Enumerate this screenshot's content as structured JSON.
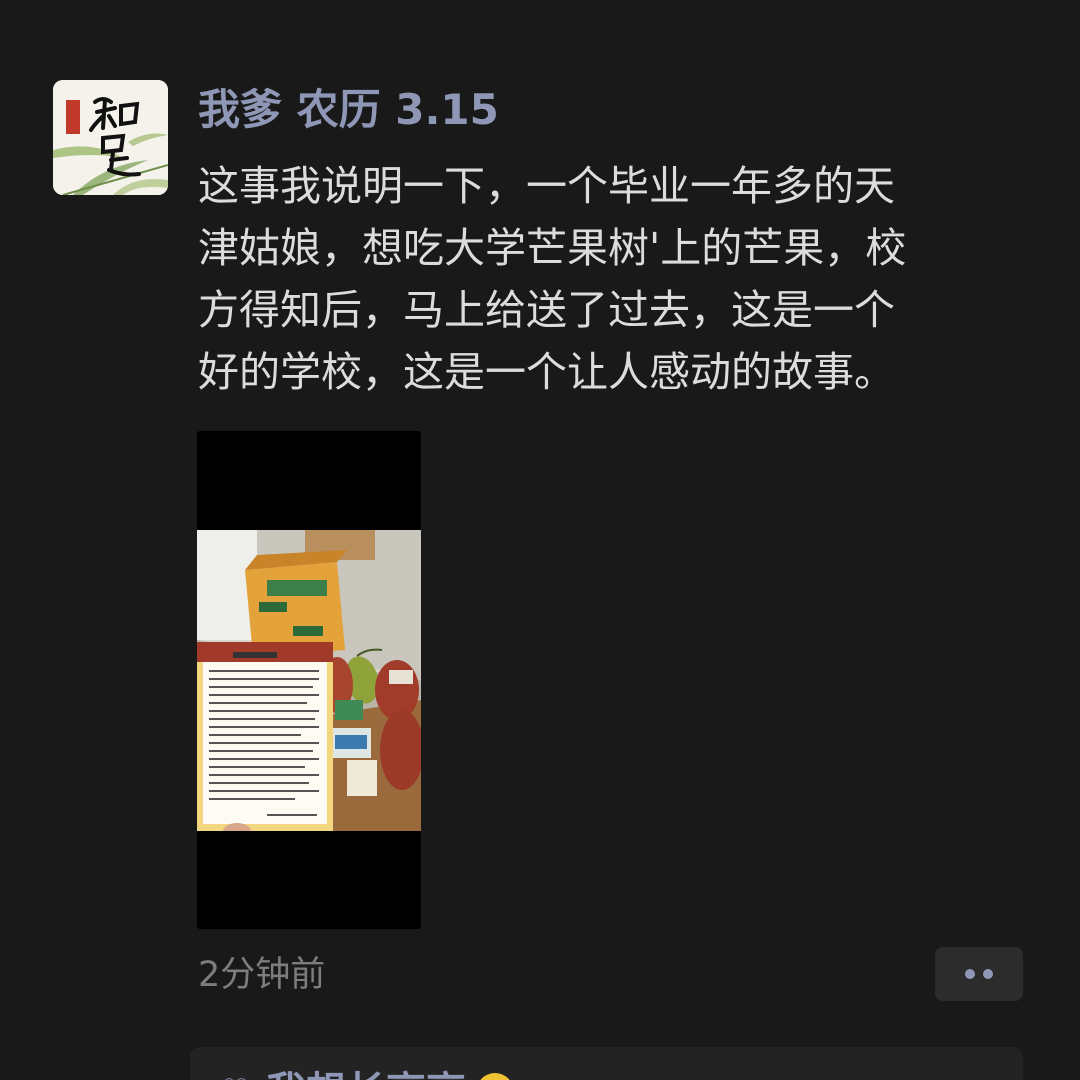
{
  "post": {
    "author": "我爹 农历 3.15",
    "avatar_icon": "zhizu-calligraphy-avatar",
    "avatar_text": "知足",
    "text_lines": [
      "这事我说明一下，一个毕业一年多的天",
      "津姑娘，想吃大学芒果树'上的芒果，校",
      "方得知后，马上给送了过去，这是一个",
      "好的学校，这是一个让人感动的故事。"
    ],
    "media": {
      "type": "video",
      "icon": "mango-box-video-thumbnail"
    },
    "timestamp": "2分钟前",
    "more_icon": "two-dots-icon"
  },
  "likes": {
    "icon": "heart-icon",
    "first_name": "我想长高高",
    "emoji_icon": "smiley-emoji-icon"
  },
  "colors": {
    "background": "#191919",
    "name": "#8e97b5",
    "text": "#dcdcdc",
    "meta": "#7d7d7d",
    "panel": "#232323"
  }
}
